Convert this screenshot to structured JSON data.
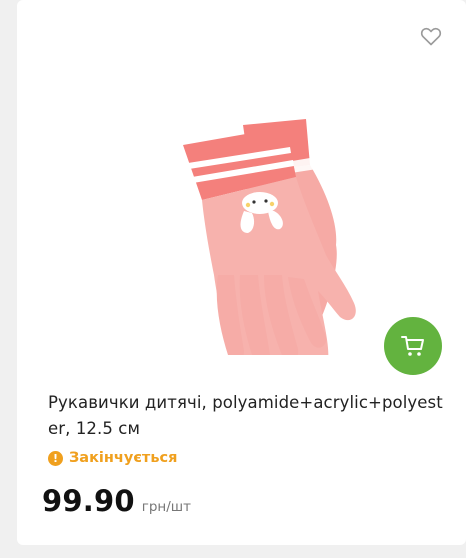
{
  "product": {
    "title": "Рукавички дитячі, polyamide+acrylic+polyester, 12.5 см",
    "status": "Закінчується",
    "price": "99.90",
    "unit": "грн/шт",
    "status_icon": "!"
  },
  "icons": {
    "favorite": "heart-outline-icon",
    "cart": "cart-icon",
    "warning": "warning-icon"
  },
  "colors": {
    "accent_green": "#63b33f",
    "status_orange": "#f0a01e"
  }
}
